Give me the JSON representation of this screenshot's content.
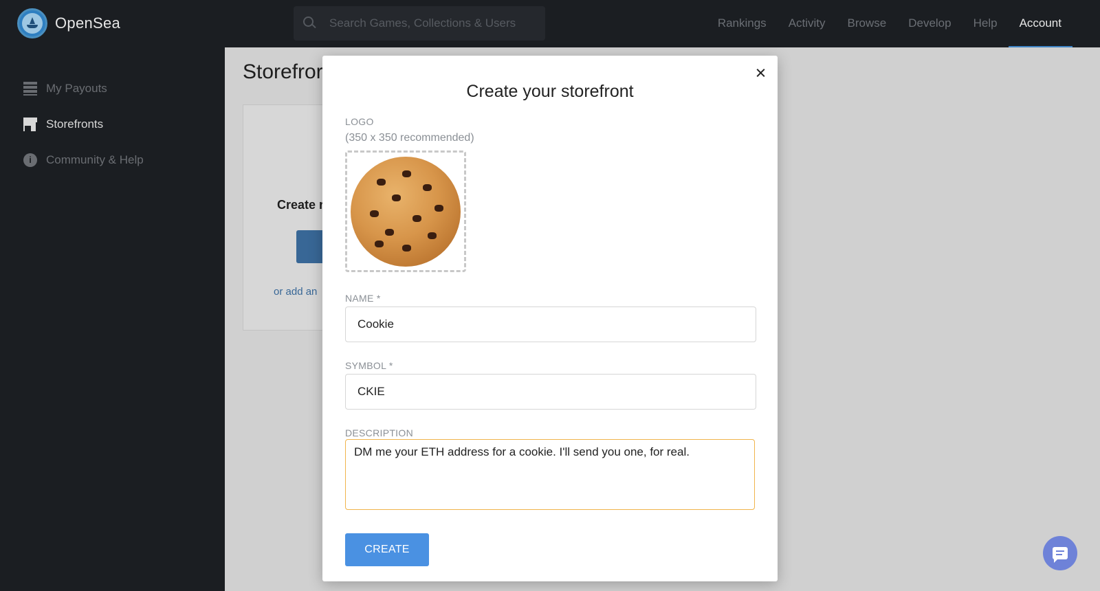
{
  "app": {
    "brand": "OpenSea"
  },
  "search": {
    "placeholder": "Search Games, Collections & Users"
  },
  "nav": {
    "items": [
      "Rankings",
      "Activity",
      "Browse",
      "Develop",
      "Help",
      "Account"
    ],
    "active": "Account"
  },
  "sidebar": {
    "items": [
      {
        "label": "My Payouts",
        "icon": "list-icon"
      },
      {
        "label": "Storefronts",
        "icon": "storefront-icon"
      },
      {
        "label": "Community & Help",
        "icon": "info-icon"
      }
    ],
    "active": "Storefronts"
  },
  "background": {
    "title": "Storefror",
    "create_text": "Create r",
    "link_text": "or add an"
  },
  "modal": {
    "title": "Create your storefront",
    "logo_label": "LOGO",
    "logo_hint": "(350 x 350 recommended)",
    "name_label": "NAME *",
    "name_value": "Cookie",
    "symbol_label": "SYMBOL *",
    "symbol_value": "CKIE",
    "description_label": "DESCRIPTION",
    "description_value": "DM me your ETH address for a cookie.  I'll send you one, for real.",
    "create_label": "CREATE"
  },
  "colors": {
    "accent": "#4a91e2",
    "focus": "#f0b44a",
    "nav_bg": "#1b1e22"
  }
}
